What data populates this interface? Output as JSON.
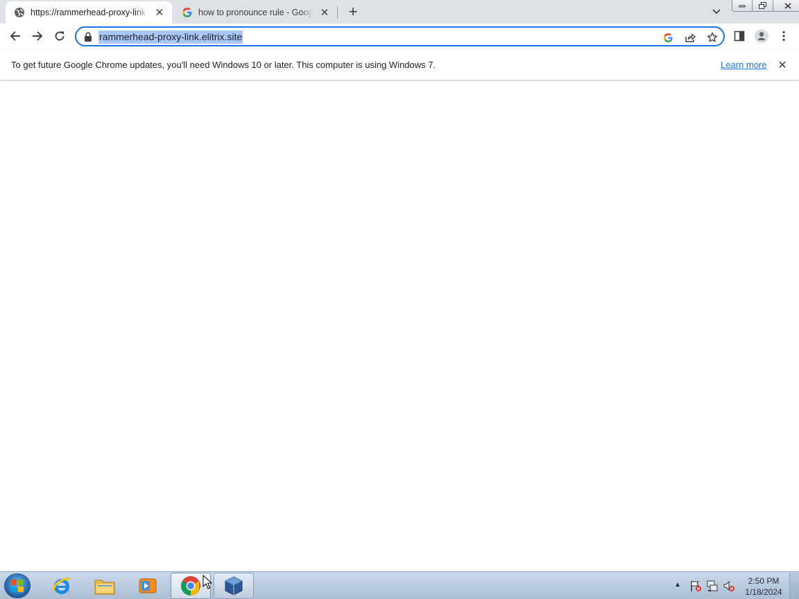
{
  "browser": {
    "tabs": [
      {
        "title": "https://rammerhead-proxy-link.elitrix.site",
        "favicon": "globe-icon",
        "active": true
      },
      {
        "title": "how to pronounce rule - Google Search",
        "favicon": "google-g-icon",
        "active": false
      }
    ],
    "omnibox": {
      "url": "rammerhead-proxy-link.elitrix.site"
    }
  },
  "infobar": {
    "message": "To get future Google Chrome updates, you'll need Windows 10 or later. This computer is using Windows 7.",
    "link_label": "Learn more"
  },
  "taskbar": {
    "pinned": [
      "internet-explorer-icon",
      "file-explorer-icon",
      "media-player-icon",
      "chrome-icon",
      "virtualbox-icon"
    ],
    "clock_time": "2:50 PM",
    "clock_date": "1/18/2024"
  },
  "colors": {
    "accent": "#1a73e8",
    "url_selection": "#a8c7fa",
    "tabstrip": "#dee1e6",
    "taskbar": "#aebfd4"
  }
}
